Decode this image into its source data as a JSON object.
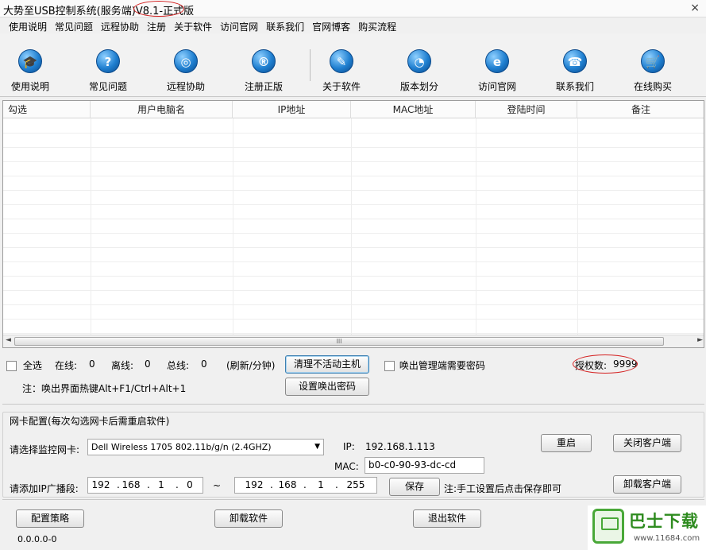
{
  "window": {
    "title_main": "大势至USB控制系统(服务端)V8.1-",
    "title_edition": "正式版",
    "close_glyph": "×"
  },
  "menu": [
    "使用说明",
    "常见问题",
    "远程协助",
    "注册",
    "关于软件",
    "访问官网",
    "联系我们",
    "官网博客",
    "购买流程"
  ],
  "toolbar": [
    {
      "label": "使用说明",
      "icon": "graduation-cap-icon",
      "glyph": "🎓"
    },
    {
      "label": "常见问题",
      "icon": "question-icon",
      "glyph": "?"
    },
    {
      "label": "远程协助",
      "icon": "globe-icon",
      "glyph": "◎"
    },
    {
      "label": "注册正版",
      "icon": "registered-icon",
      "glyph": "®"
    },
    {
      "label": "关于软件",
      "icon": "document-icon",
      "glyph": "✎"
    },
    {
      "label": "版本划分",
      "icon": "pie-chart-icon",
      "glyph": "◔"
    },
    {
      "label": "访问官网",
      "icon": "ie-icon",
      "glyph": "e"
    },
    {
      "label": "联系我们",
      "icon": "phone-icon",
      "glyph": "☎"
    },
    {
      "label": "在线购买",
      "icon": "cart-icon",
      "glyph": "🛒"
    }
  ],
  "table": {
    "columns": [
      "勾选",
      "用户电脑名",
      "IP地址",
      "MAC地址",
      "登陆时间",
      "备注"
    ],
    "rows": [],
    "hscroll_grip": "III"
  },
  "status": {
    "select_all": "全选",
    "online_label": "在线:",
    "online_value": "0",
    "offline_label": "离线:",
    "offline_value": "0",
    "total_label": "总线:",
    "total_value": "0",
    "refresh": "(刷新/分钟)",
    "clean_button": "清理不活动主机",
    "password_check": "唤出管理端需要密码",
    "auth_label": "授权数:",
    "auth_value": "9999",
    "hotkey_note": "注：唤出界面热键Alt+F1/Ctrl+Alt+1",
    "set_password_button": "设置唤出密码"
  },
  "nic": {
    "group_title": "网卡配置(每次勾选网卡后需重启软件)",
    "select_label": "请选择监控网卡:",
    "selected_nic": "Dell Wireless 1705 802.11b/g/n (2.4GHZ)",
    "ip_label": "IP:",
    "ip_value": "192.168.1.113",
    "mac_label": "MAC:",
    "mac_value": "b0-c0-90-93-dc-cd",
    "broadcast_label": "请添加IP广播段:",
    "start_ip": [
      "192",
      "168",
      "1",
      "0"
    ],
    "range_sep": "~",
    "end_ip": [
      "192",
      "168",
      "1",
      "255"
    ],
    "save_button": "保存",
    "save_note": "注:手工设置后点击保存即可",
    "restart_button": "重启",
    "close_client_button": "关闭客户端",
    "uninstall_client_button": "卸载客户端"
  },
  "footer": {
    "policy_button": "配置策略",
    "uninstall_button": "卸载软件",
    "exit_button": "退出软件",
    "version": "0.0.0.0-0"
  },
  "watermark": {
    "brand": "巴士下载",
    "url": "www.11684.com"
  }
}
